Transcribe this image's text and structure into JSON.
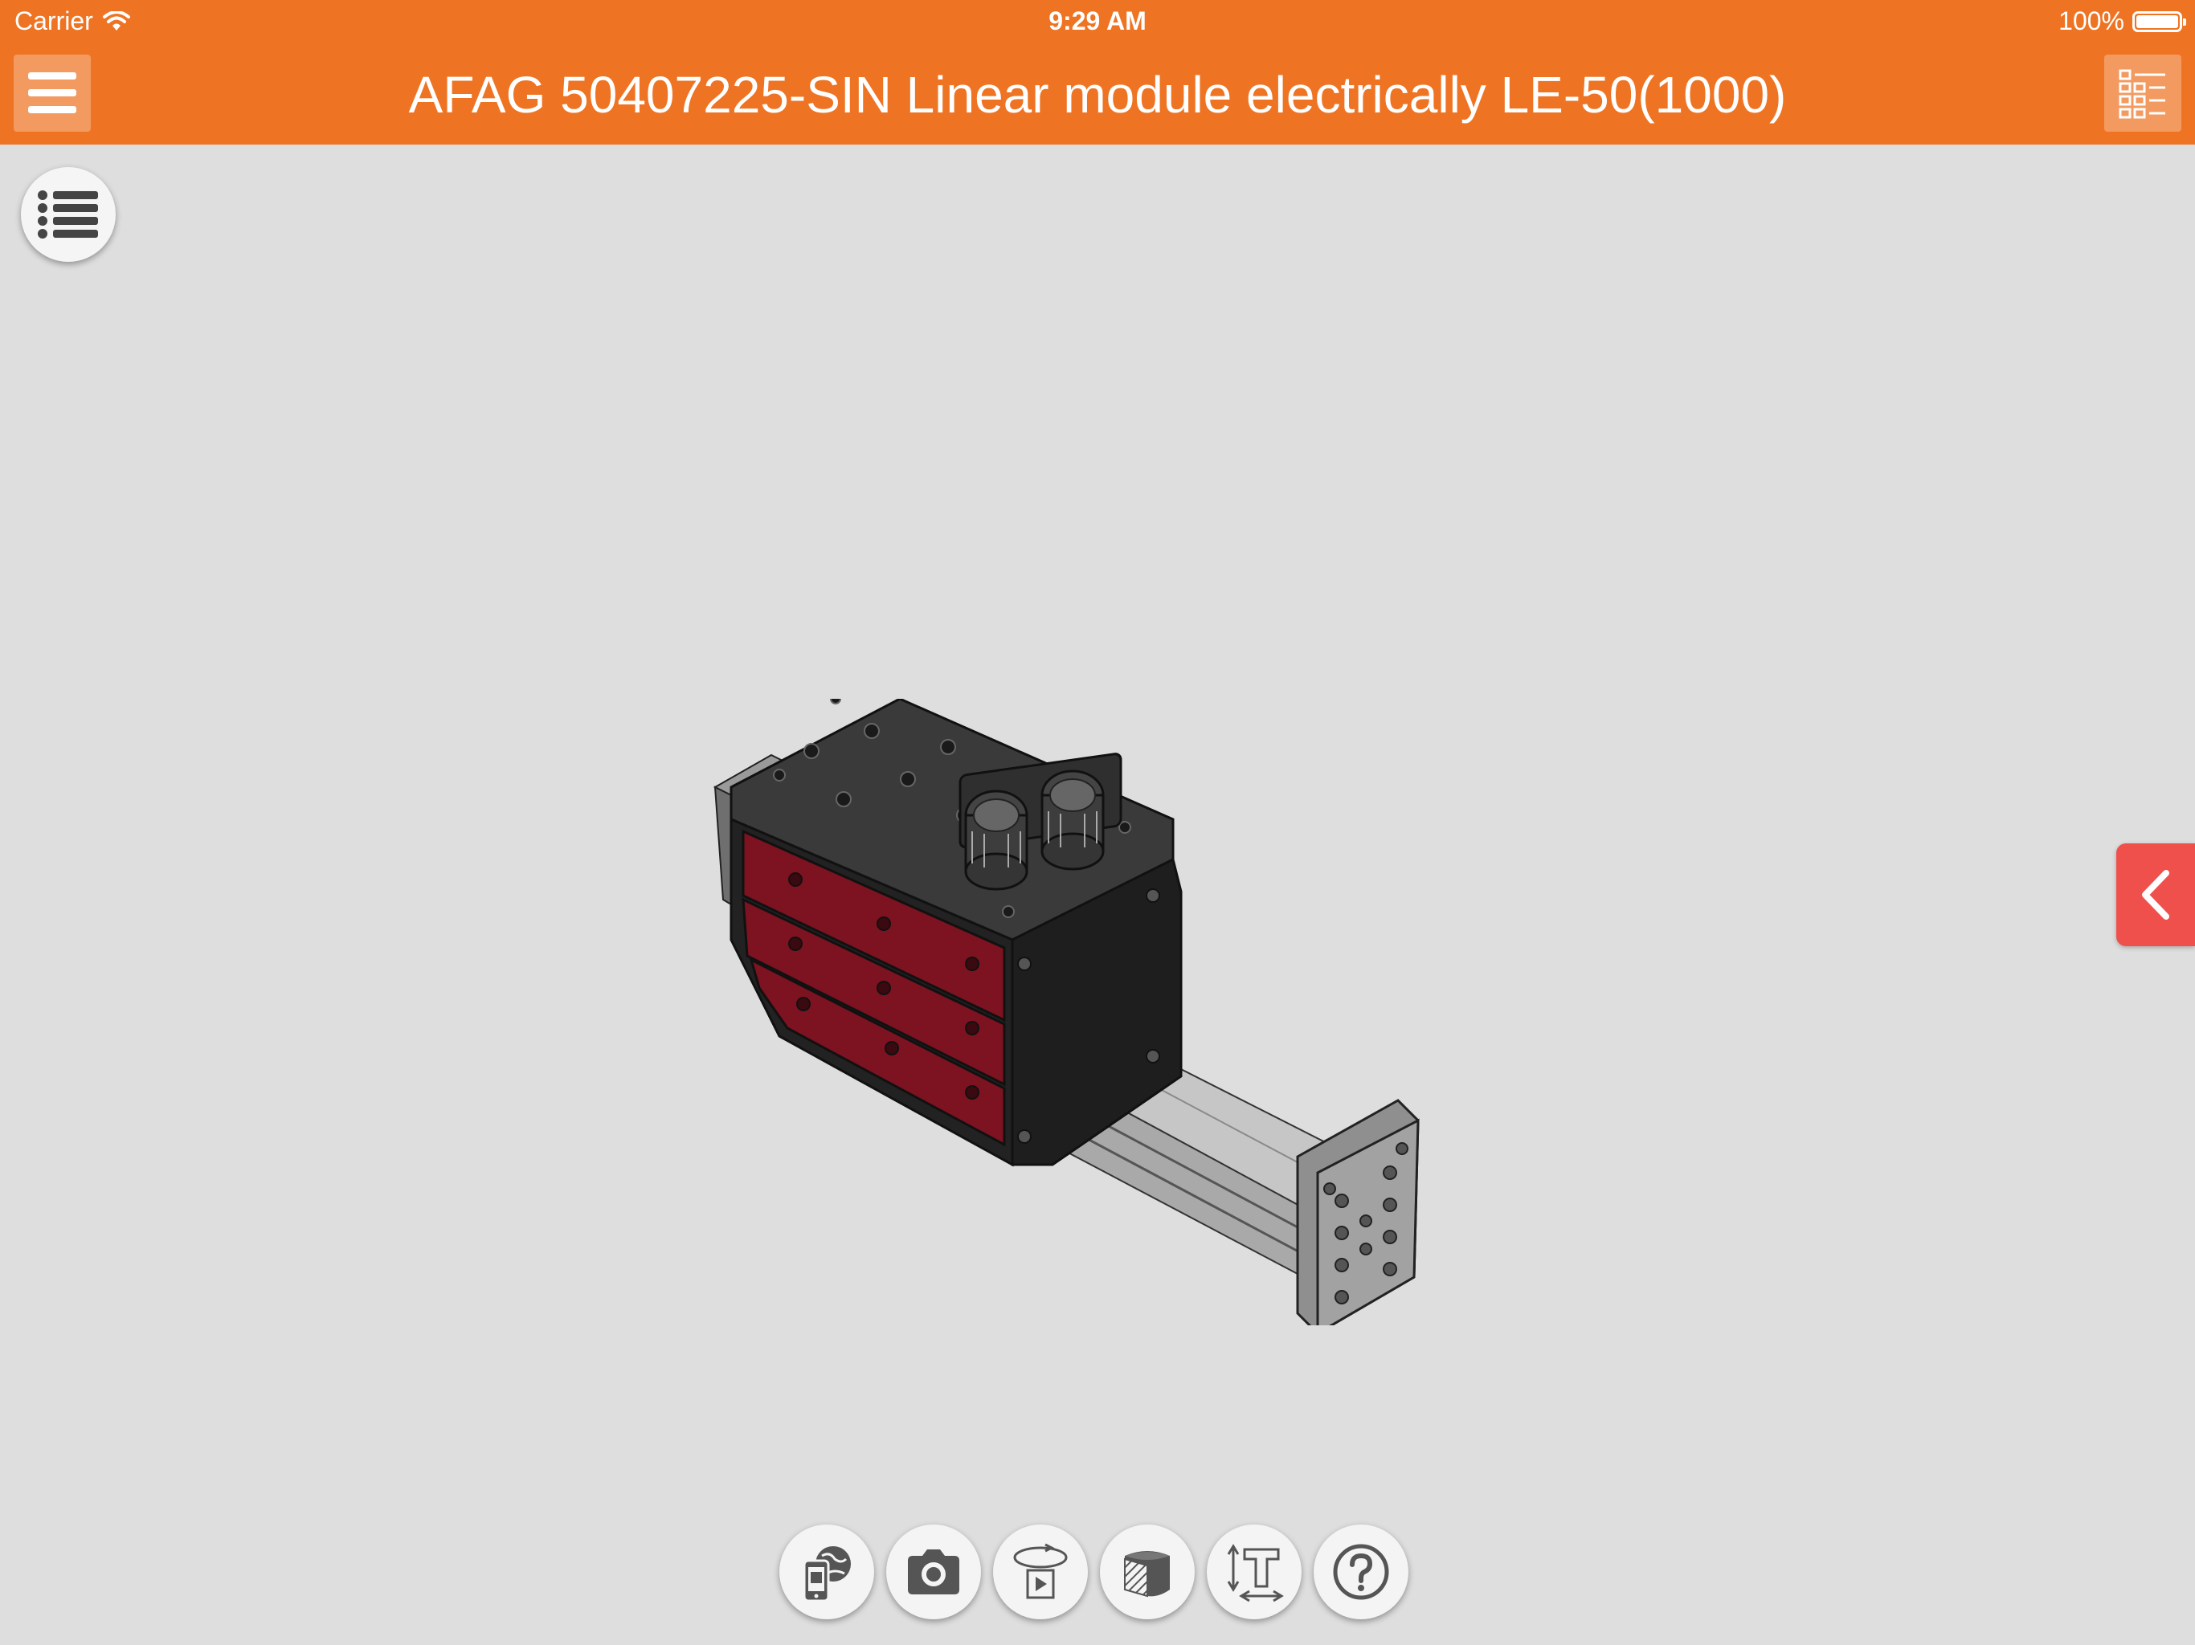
{
  "status_bar": {
    "carrier": "Carrier",
    "time": "9:29 AM",
    "battery": "100%"
  },
  "header": {
    "title": "AFAG 50407225-SIN Linear module electrically LE-50(1000)",
    "background_color": "#ee7424"
  },
  "icons": {
    "menu": "hamburger-menu-icon",
    "list_view": "list-view-icon",
    "parts": "parts-list-icon",
    "drawer": "chevron-left-icon",
    "toolbar": [
      "ar-view-icon",
      "camera-icon",
      "rotate-animation-icon",
      "section-cut-icon",
      "dimension-icon",
      "help-icon"
    ]
  },
  "colors": {
    "viewport_bg": "#dedede",
    "drawer_tab": "#f0504b",
    "model_body": "#2b2b2b",
    "model_accent": "#7d1220",
    "model_rail": "#b9b9b9"
  }
}
